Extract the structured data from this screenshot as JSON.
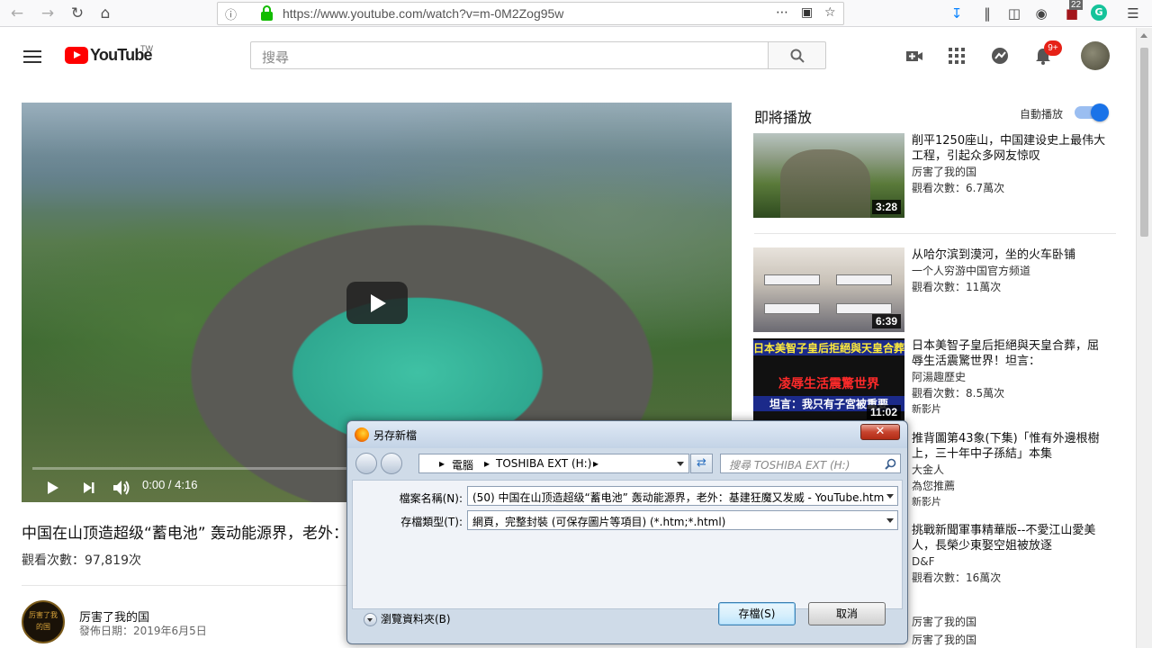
{
  "browser": {
    "url": "https://www.youtube.com/watch?v=m-0M2Zog95w",
    "tab_count_badge": "22",
    "icons": [
      "back-icon",
      "forward-icon",
      "reload-icon",
      "home-icon",
      "info-icon",
      "lock-icon",
      "more-icon",
      "pocket-icon",
      "bookmark-star-icon",
      "download-icon",
      "library-icon",
      "sidebar-icon",
      "account-icon",
      "extension-icon",
      "grammarly-icon",
      "menu-icon"
    ]
  },
  "header": {
    "logo_text": "YouTube",
    "logo_region": "TW",
    "search_placeholder": "搜尋",
    "notification_badge": "9+"
  },
  "player": {
    "time": "0:00 / 4:16",
    "progress_fraction": 0
  },
  "video": {
    "title": "中国在山顶造超级“蓄电池” 轰动能源界，老外：基建狂魔又发威",
    "views": "觀看次數：97,819次",
    "channel": "厉害了我的国",
    "publish_date": "發佈日期：2019年6月5日",
    "avatar_text": "厉害了我的国"
  },
  "upnext": {
    "title": "即將播放",
    "autoplay_label": "自動播放",
    "autoplay_on": true
  },
  "recommendations": [
    {
      "title": "削平1250座山，中国建设史上最伟大工程，引起众多网友惊叹",
      "channel": "厉害了我的国",
      "views": "觀看次數：6.7萬次",
      "duration": "3:28",
      "extra": ""
    },
    {
      "title": "从哈尔滨到漠河，坐的火车卧铺",
      "channel": "一个人穷游中国官方频道",
      "views": "觀看次數：11萬次",
      "duration": "6:39",
      "extra": ""
    },
    {
      "title": "日本美智子皇后拒絕與天皇合葬，屈辱生活震驚世界！坦言：",
      "channel": "阿湯趣歷史",
      "views": "觀看次數：8.5萬次",
      "duration": "11:02",
      "extra": "新影片",
      "thumb_lines": [
        "日本美智子皇后拒絕與天皇合葬",
        "凌辱生活震驚世界",
        "坦言：我只有子宮被重要"
      ]
    },
    {
      "title": "推背圖第43象(下集)「惟有外邊根樹上，三十年中子孫結」本集",
      "channel": "大金人",
      "views": "為您推薦",
      "duration": "",
      "extra": "新影片"
    },
    {
      "title": "挑戰新聞軍事精華版--不愛江山愛美人，長榮少東娶空姐被放逐",
      "channel": "D&F",
      "views": "觀看次數：16萬次",
      "duration": "",
      "extra": ""
    },
    {
      "title": "",
      "channel": "厉害了我的国",
      "views": "",
      "duration": "",
      "extra": ""
    },
    {
      "title": "",
      "channel": "厉害了我的国",
      "views": "",
      "duration": "",
      "extra": ""
    }
  ],
  "dialog": {
    "title": "另存新檔",
    "close": "✕",
    "path": [
      "電腦",
      "TOSHIBA EXT (H:)"
    ],
    "search_placeholder": "搜尋 TOSHIBA EXT (H:)",
    "filename_label": "檔案名稱(N):",
    "filename_value": "(50) 中国在山顶造超级“蓄电池” 轰动能源界，老外：基建狂魔又发威 - YouTube.htm",
    "filetype_label": "存檔類型(T):",
    "filetype_value": "網頁，完整封裝 (可保存圖片等項目) (*.htm;*.html)",
    "browse_label": "瀏覽資料夾(B)",
    "save_label": "存檔(S)",
    "cancel_label": "取消"
  }
}
